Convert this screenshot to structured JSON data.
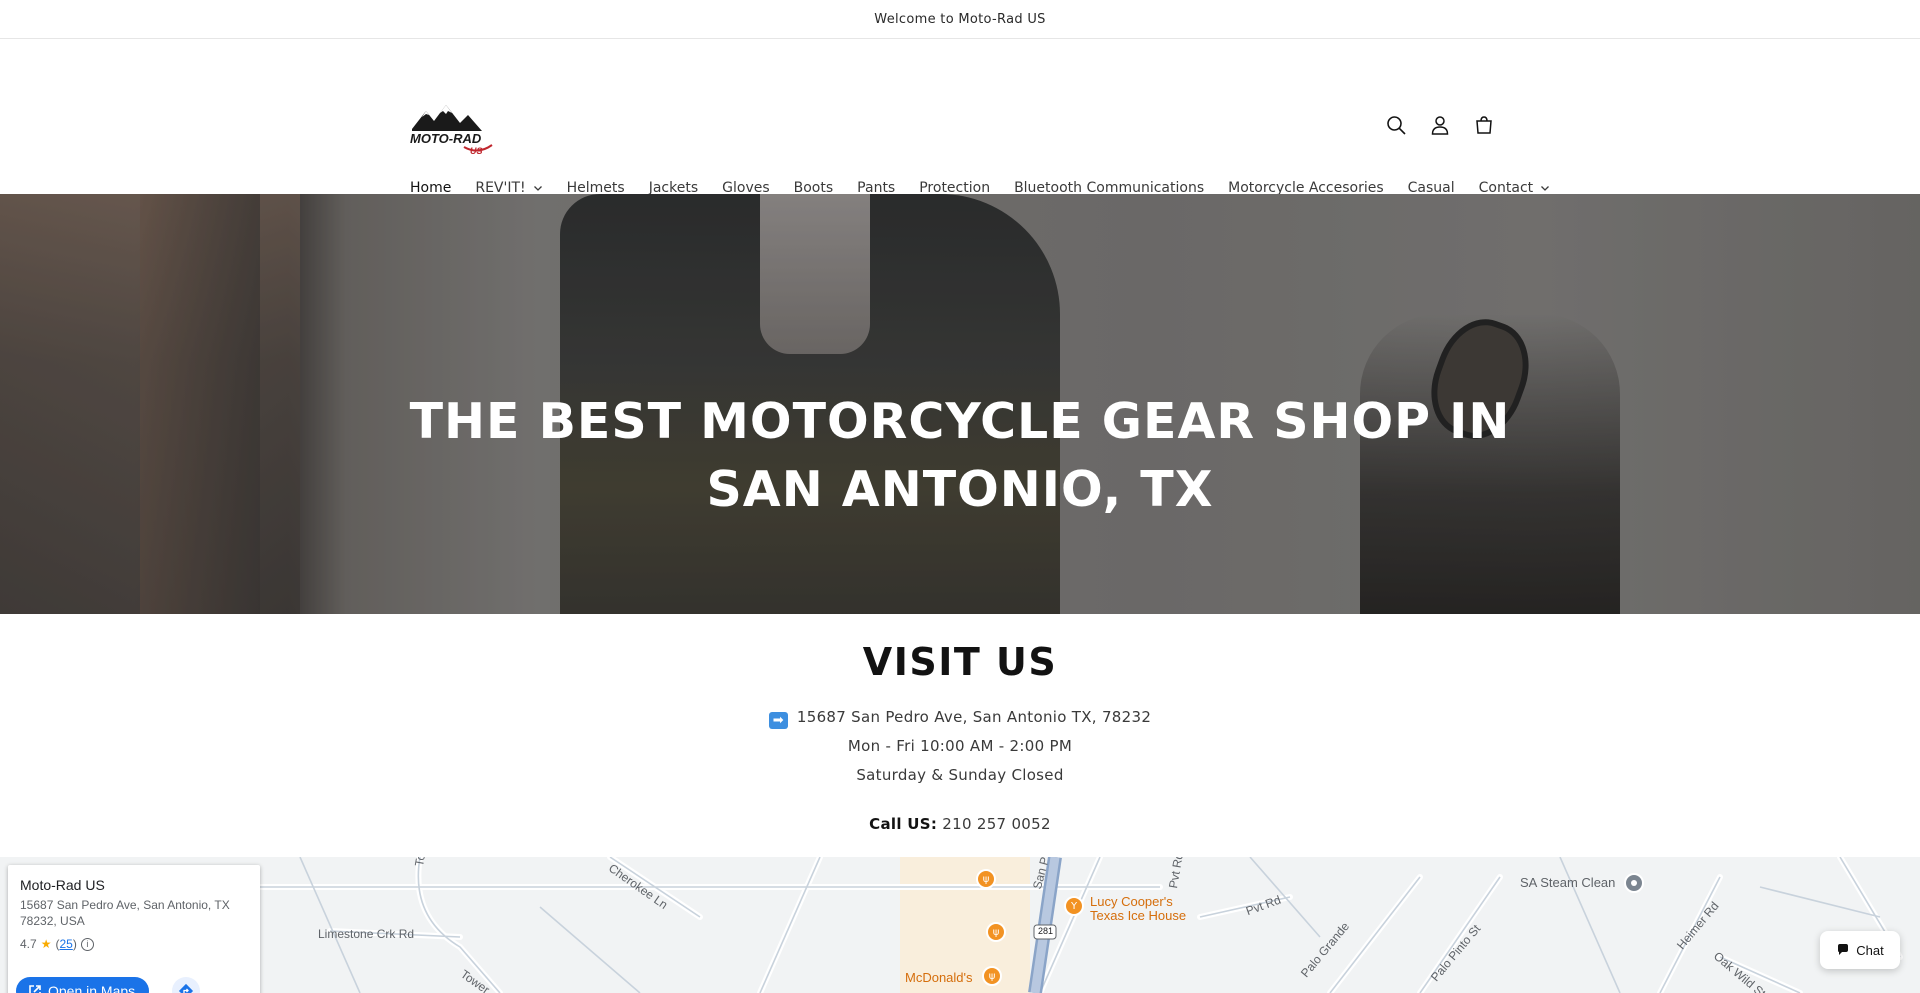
{
  "announcement": {
    "text": "Welcome to Moto-Rad US"
  },
  "header": {
    "logo_text": "MOTO-RAD",
    "logo_sub": "US",
    "icons": [
      "search-icon",
      "account-icon",
      "cart-icon"
    ]
  },
  "nav": {
    "items": [
      {
        "label": "Home",
        "active": true,
        "dropdown": false
      },
      {
        "label": "REV'IT!",
        "active": false,
        "dropdown": true
      },
      {
        "label": "Helmets",
        "active": false,
        "dropdown": false
      },
      {
        "label": "Jackets",
        "active": false,
        "dropdown": false
      },
      {
        "label": "Gloves",
        "active": false,
        "dropdown": false
      },
      {
        "label": "Boots",
        "active": false,
        "dropdown": false
      },
      {
        "label": "Pants",
        "active": false,
        "dropdown": false
      },
      {
        "label": "Protection",
        "active": false,
        "dropdown": false
      },
      {
        "label": "Bluetooth Communications",
        "active": false,
        "dropdown": false
      },
      {
        "label": "Motorcycle Accesories",
        "active": false,
        "dropdown": false
      },
      {
        "label": "Casual",
        "active": false,
        "dropdown": false
      },
      {
        "label": "Contact",
        "active": false,
        "dropdown": true
      }
    ]
  },
  "hero": {
    "headline_line1": "THE BEST MOTORCYCLE GEAR SHOP IN",
    "headline_line2": "SAN ANTONIO, TX"
  },
  "visit": {
    "title": "VISIT US",
    "arrow": "➡",
    "address": "15687 San Pedro Ave, San Antonio TX, 78232",
    "hours": "Mon - Fri 10:00 AM - 2:00 PM",
    "weekend": "Saturday & Sunday Closed",
    "call_label": "Call US:",
    "phone": "210 257 0052"
  },
  "map": {
    "place_name": "Moto-Rad US",
    "place_address": "15687 San Pedro Ave, San Antonio, TX 78232, USA",
    "rating": "4.7",
    "review_count": "25",
    "open_in_maps": "Open in Maps",
    "labels": {
      "tower1": "Tower",
      "cherokee": "Cherokee Ln",
      "limestone": "Limestone Crk Rd",
      "tower2": "Tower",
      "san_pedro": "San P",
      "pvt_rd_vertical": "Pvt Rd",
      "pvt_rd": "Pvt Rd",
      "palo_grande": "Palo Grande",
      "palo_pinto": "Palo Pinto St",
      "heimer": "Heimer Rd",
      "oak_wild": "Oak Wild St",
      "highway": "281",
      "lucy_line1": "Lucy Cooper's",
      "lucy_line2": "Texas Ice House",
      "mcdonalds": "McDonald's",
      "sa_steam": "SA Steam Clean"
    }
  },
  "chat": {
    "label": "Chat"
  },
  "colors": {
    "accent_blue": "#1a73e8",
    "poi_orange": "#f29222",
    "text_dark": "#121212"
  }
}
